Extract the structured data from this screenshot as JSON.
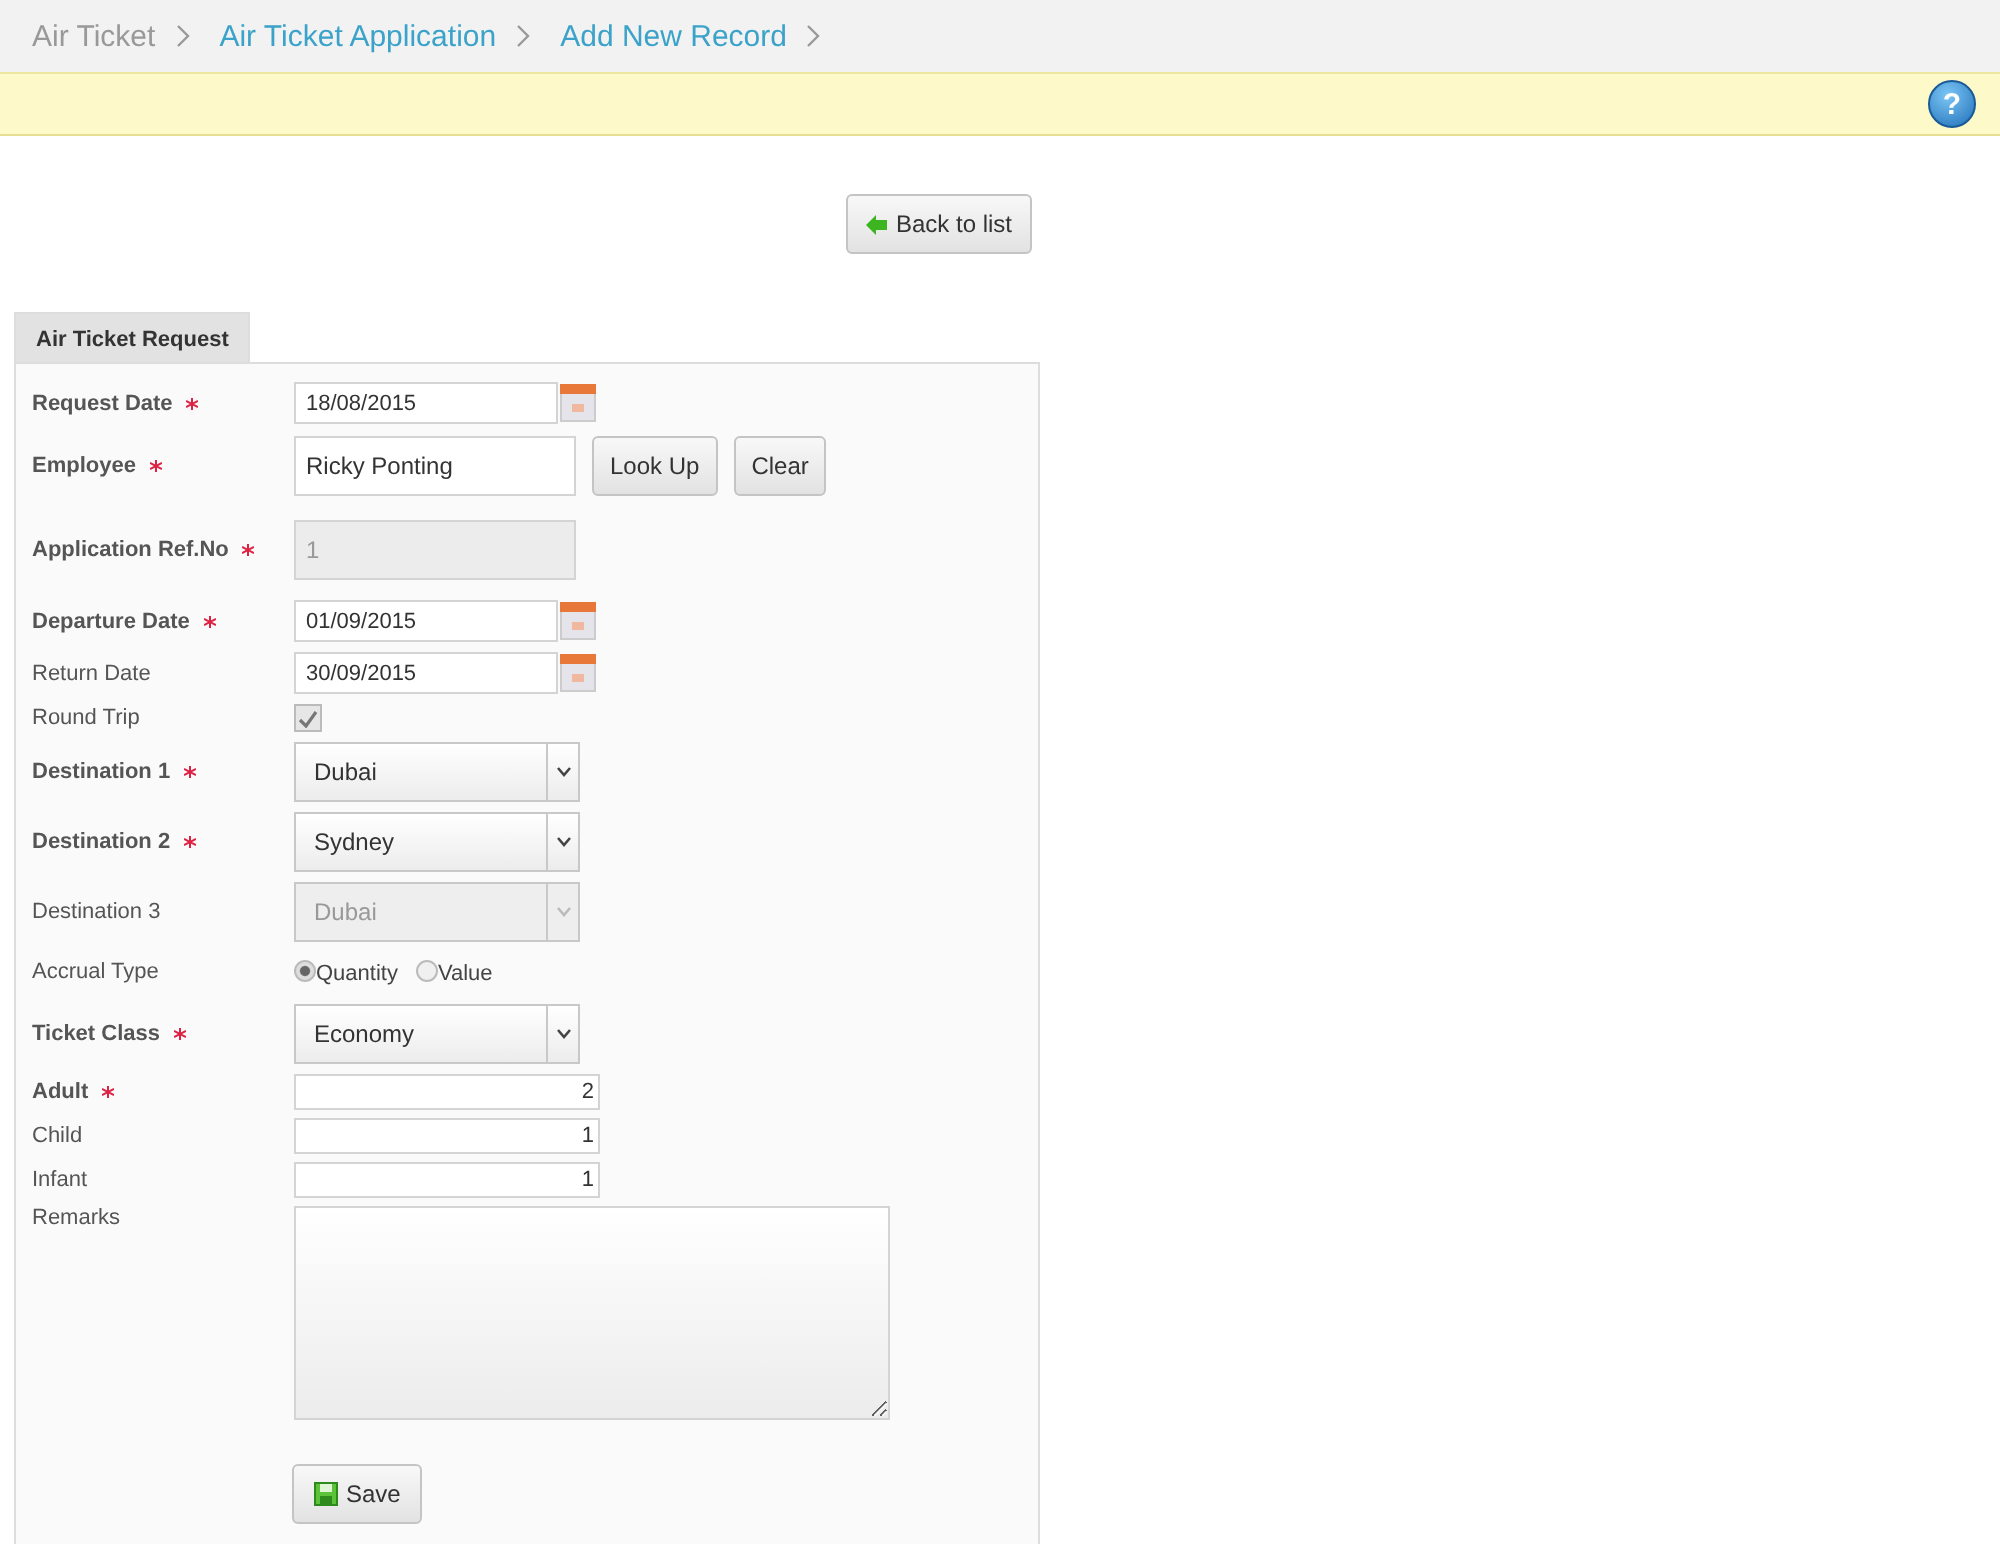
{
  "breadcrumb": [
    {
      "label": "Air Ticket",
      "link": false
    },
    {
      "label": "Air Ticket Application",
      "link": true
    },
    {
      "label": "Add New Record",
      "link": true
    }
  ],
  "help_icon": "?",
  "back_button": "Back to list",
  "tab": {
    "label": "Air Ticket Request",
    "selected": true
  },
  "fields": [
    {
      "kind": "date",
      "label": "Request Date",
      "required": true,
      "value": "18/08/2015"
    },
    {
      "kind": "lookup",
      "label": "Employee",
      "required": true,
      "value": "Ricky Ponting",
      "buttons": [
        "Look Up",
        "Clear"
      ]
    },
    {
      "kind": "readonly",
      "label": "Application Ref.No",
      "required": true,
      "value": "1"
    },
    {
      "kind": "date",
      "label": "Departure Date",
      "required": true,
      "value": "01/09/2015"
    },
    {
      "kind": "date",
      "label": "Return Date",
      "required": false,
      "value": "30/09/2015"
    },
    {
      "kind": "checkbox",
      "label": "Round Trip",
      "required": false,
      "checked": true
    },
    {
      "kind": "select",
      "label": "Destination 1",
      "required": true,
      "value": "Dubai",
      "disabled": false
    },
    {
      "kind": "select",
      "label": "Destination 2",
      "required": true,
      "value": "Sydney",
      "disabled": false
    },
    {
      "kind": "select",
      "label": "Destination 3",
      "required": false,
      "value": "Dubai",
      "disabled": true
    },
    {
      "kind": "radio",
      "label": "Accrual Type",
      "required": false,
      "options": [
        {
          "label": "Quantity",
          "selected": true
        },
        {
          "label": "Value",
          "selected": false
        }
      ]
    },
    {
      "kind": "select",
      "label": "Ticket Class",
      "required": true,
      "value": "Economy",
      "disabled": false
    },
    {
      "kind": "number",
      "label": "Adult",
      "required": true,
      "value": "2"
    },
    {
      "kind": "number",
      "label": "Child",
      "required": false,
      "value": "1"
    },
    {
      "kind": "number",
      "label": "Infant",
      "required": false,
      "value": "1"
    },
    {
      "kind": "textarea",
      "label": "Remarks",
      "required": false
    }
  ],
  "save_button": "Save"
}
